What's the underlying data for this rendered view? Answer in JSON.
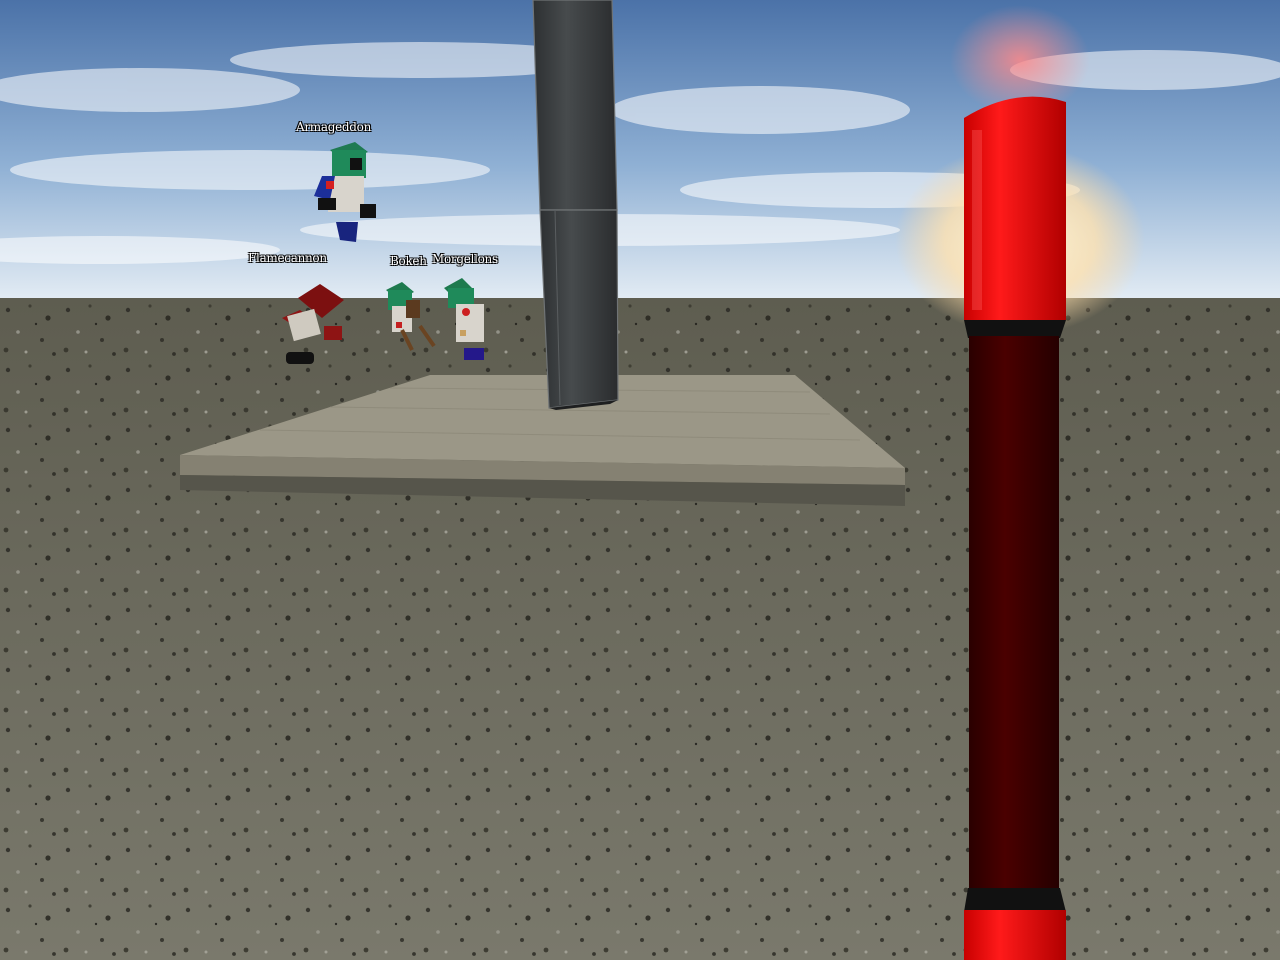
{
  "players": [
    {
      "name": "Armageddon"
    },
    {
      "name": "Flamecannon"
    },
    {
      "name": "Bokeh"
    },
    {
      "name": "Morgellons"
    }
  ],
  "colors": {
    "sky_top": "#4f77ad",
    "sky_horizon": "#d9e6f2",
    "ground": "#6b6a5c",
    "platform_top": "#9c9888",
    "pillar": "#3a3d3e",
    "stick_red": "#ff0000",
    "stick_dark": "#3d0000"
  }
}
